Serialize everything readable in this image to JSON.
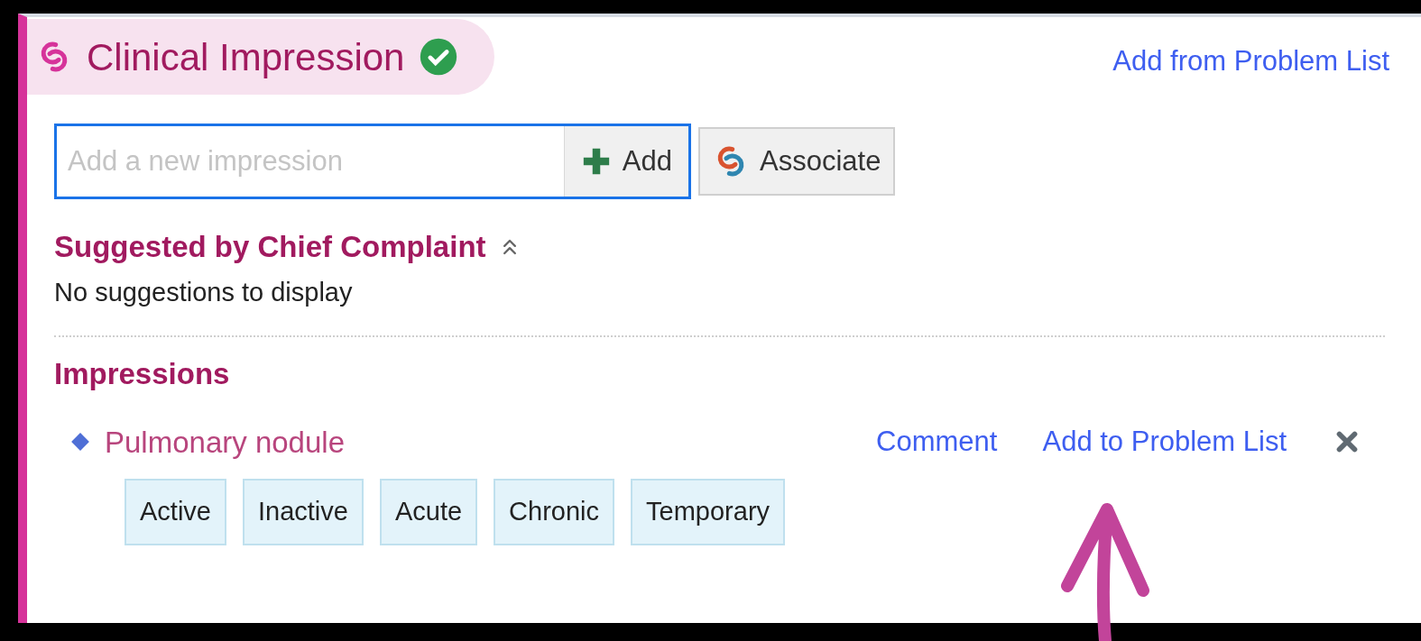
{
  "panel": {
    "title": "Clinical Impression",
    "complete": true,
    "header_link": "Add from Problem List"
  },
  "entry": {
    "placeholder": "Add a new impression",
    "add_button": "Add",
    "associate_button": "Associate"
  },
  "suggested": {
    "heading": "Suggested by Chief Complaint",
    "expanded": true,
    "empty_text": "No suggestions to display"
  },
  "impressions": {
    "heading": "Impressions",
    "items": [
      {
        "name": "Pulmonary nodule",
        "actions": [
          "Comment",
          "Add to Problem List"
        ],
        "status_options": [
          "Active",
          "Inactive",
          "Acute",
          "Chronic",
          "Temporary"
        ]
      }
    ]
  }
}
